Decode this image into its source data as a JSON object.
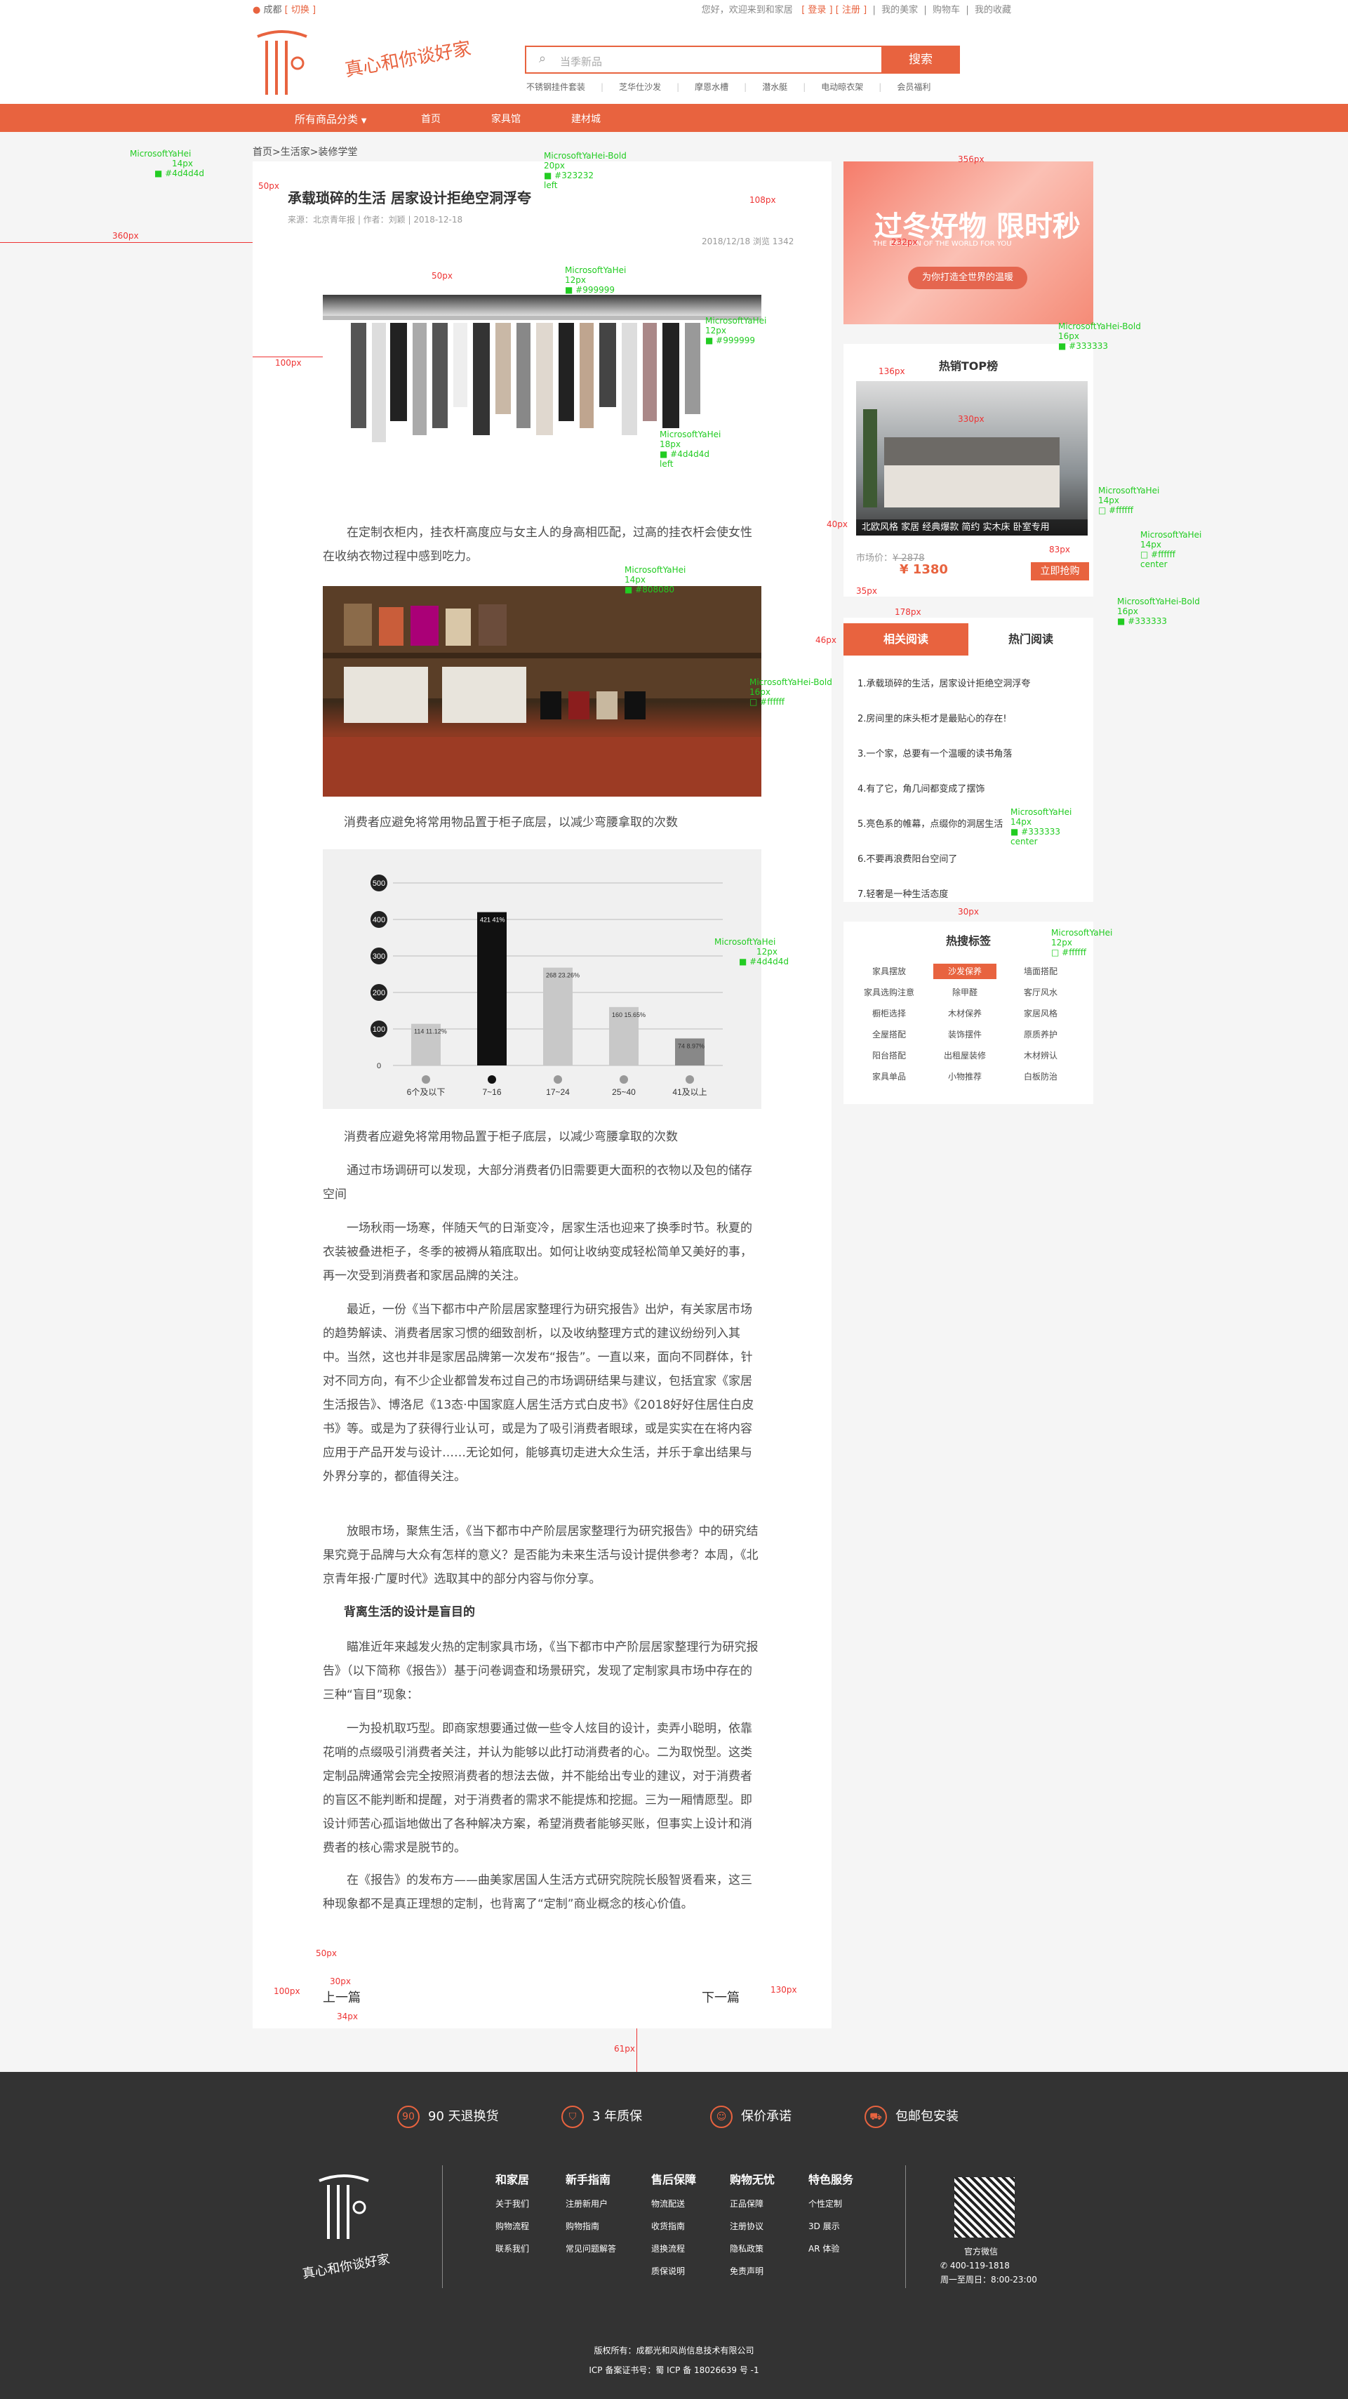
{
  "topbar": {
    "location": "成都",
    "switch": "[ 切换 ]",
    "welcome": "您好，欢迎来到和家居",
    "login": "[ 登录 ]",
    "register": "[ 注册 ]",
    "my_home": "我的美家",
    "cart": "购物车",
    "favorites": "我的收藏"
  },
  "header": {
    "slogan": "真心和你谈好家",
    "search_placeholder": "当季新品",
    "search_button": "搜索",
    "hotwords": [
      "不锈钢挂件套装",
      "芝华仕沙发",
      "摩恩水槽",
      "潜水艇",
      "电动晾衣架",
      "会员福利"
    ]
  },
  "nav": {
    "category": "所有商品分类",
    "items": [
      "首页",
      "家具馆",
      "建材城"
    ]
  },
  "article": {
    "breadcrumb": "首页>生活家>装修学堂",
    "title": "承载琐碎的生活 居家设计拒绝空洞浮夸",
    "meta": "来源：北京青年报  |  作者：刘颖  |  2018-12-18",
    "side_meta": "2018/12/18    浏览 1342",
    "p1": "在定制衣柜内，挂衣杆高度应与女主人的身高相匹配，过高的挂衣杆会使女性在收纳衣物过程中感到吃力。",
    "p2": "消费者应避免将常用物品置于柜子底层，以减少弯腰拿取的次数",
    "p3": "消费者应避免将常用物品置于柜子底层，以减少弯腰拿取的次数",
    "p4": "通过市场调研可以发现，大部分消费者仍旧需要更大面积的衣物以及包的储存空间",
    "p5": "一场秋雨一场寒，伴随天气的日渐变冷，居家生活也迎来了换季时节。秋夏的衣装被叠进柜子，冬季的被褥从箱底取出。如何让收纳变成轻松简单又美好的事，再一次受到消费者和家居品牌的关注。",
    "p6": "最近，一份《当下都市中产阶层居家整理行为研究报告》出炉，有关家居市场的趋势解读、消费者居家习惯的细致剖析，以及收纳整理方式的建议纷纷列入其中。当然，这也并非是家居品牌第一次发布“报告”。一直以来，面向不同群体，针对不同方向，有不少企业都曾发布过自己的市场调研结果与建议，包括宜家《家居生活报告》、博洛尼《13态·中国家庭人居生活方式白皮书》《2018好好住居住白皮书》等。或是为了获得行业认可，或是为了吸引消费者眼球，或是实实在在将内容应用于产品开发与设计……无论如何，能够真切走进大众生活，并乐于拿出结果与外界分享的，都值得关注。",
    "p7": "放眼市场，聚焦生活，《当下都市中产阶层居家整理行为研究报告》中的研究结果究竟于品牌与大众有怎样的意义？是否能为未来生活与设计提供参考？本周，《北京青年报·广厦时代》选取其中的部分内容与你分享。",
    "section_title": "背离生活的设计是盲目的",
    "p8": "瞄准近年来越发火热的定制家具市场，《当下都市中产阶层居家整理行为研究报告》（以下简称《报告》）基于问卷调查和场景研究，发现了定制家具市场中存在的三种“盲目”现象：",
    "p9": "一为投机取巧型。即商家想要通过做一些令人炫目的设计，卖弄小聪明，依靠花哨的点缀吸引消费者关注，并认为能够以此打动消费者的心。二为取悦型。这类定制品牌通常会完全按照消费者的想法去做，并不能给出专业的建议，对于消费者的盲区不能判断和提醒，对于消费者的需求不能提炼和挖掘。三为一厢情愿型。即设计师苦心孤诣地做出了各种解决方案，希望消费者能够买账，但事实上设计和消费者的核心需求是脱节的。",
    "p10": "在《报告》的发布方——曲美家居国人生活方式研究院院长殷智贤看来，这三种现象都不是真正理想的定制，也背离了“定制”商业概念的核心价值。",
    "prev": "上一篇",
    "next": "下一篇"
  },
  "chart_data": {
    "type": "bar",
    "categories": [
      "6个及以下",
      "7~16",
      "17~24",
      "25~40",
      "41及以上"
    ],
    "values": [
      114,
      420,
      268,
      160,
      74
    ],
    "data_labels": [
      "114 11.12%",
      "421 41%",
      "268 23.26%",
      "160 15.65%",
      "74 8.97%"
    ],
    "ylim": [
      0,
      500
    ],
    "yticks": [
      0,
      100,
      200,
      300,
      400,
      500
    ],
    "highlight_index": 1,
    "colors": {
      "bar": "#c8c8c8",
      "highlight": "#111111",
      "last": "#888888"
    }
  },
  "sidebar": {
    "banner": {
      "title": "过冬好物 限时秒",
      "subtitle": "THE BARGAIN OF THE WORLD FOR YOU",
      "button": "为你打造全世界的温暖"
    },
    "top_title": "热销TOP榜",
    "product_caption": "北欧风格 家居 经典爆款 简约 实木床 卧室专用",
    "market_price_label": "市场价：",
    "market_price": "¥ 2878",
    "price": "¥ 1380",
    "buy": "立即抢购",
    "tab_related": "相关阅读",
    "tab_hot": "热门阅读",
    "read_list": [
      "1.承载琐碎的生活，居家设计拒绝空洞浮夸",
      "2.房间里的床头柜才是最贴心的存在!",
      "3.一个家，总要有一个温暖的读书角落",
      "4.有了它，角几间都变成了摆饰",
      "5.亮色系的帷幕，点缀你的洞居生活",
      "6.不要再浪费阳台空间了",
      "7.轻奢是一种生活态度"
    ],
    "tags_title": "热搜标签",
    "tags": [
      "家具摆放",
      "沙发保养",
      "墙面搭配",
      "家具选购注意",
      "除甲醛",
      "客厅风水",
      "橱柜选择",
      "木材保养",
      "家居风格",
      "全屋搭配",
      "装饰摆件",
      "原质养护",
      "阳台搭配",
      "出租屋装修",
      "木材辨认",
      "家具单品",
      "小物推荐",
      "白板防治"
    ],
    "active_tag": 1
  },
  "footer": {
    "services": [
      "90 天退换货",
      "3 年质保",
      "保价承诺",
      "包邮包安装"
    ],
    "service_icons": [
      "90-icon",
      "shield-icon",
      "person-icon",
      "truck-icon"
    ],
    "slogan": "真心和你谈好家",
    "cols": [
      {
        "h": "和家居",
        "items": [
          "关于我们",
          "购物流程",
          "联系我们"
        ]
      },
      {
        "h": "新手指南",
        "items": [
          "注册新用户",
          "购物指南",
          "常见问题解答"
        ]
      },
      {
        "h": "售后保障",
        "items": [
          "物流配送",
          "收货指南",
          "退换流程",
          "质保说明"
        ]
      },
      {
        "h": "购物无忧",
        "items": [
          "正品保障",
          "注册协议",
          "隐私政策",
          "免责声明"
        ]
      },
      {
        "h": "特色服务",
        "items": [
          "个性定制",
          "3D 展示",
          "AR 体验"
        ]
      }
    ],
    "wechat": "官方微信",
    "phone": "400-119-1818",
    "hours": "周一至周日：8:00-23:00",
    "copyright": "版权所有：成都光和风尚信息技术有限公司",
    "icp": "ICP 备案证书号：蜀 ICP 备 18026639 号 -1"
  },
  "annotations": {
    "font_regular": "MicrosoftYaHei",
    "font_bold": "MicrosoftYaHei-Bold",
    "size12": "12px",
    "size14": "14px",
    "size16": "16px",
    "size17": "17px",
    "size18": "18px",
    "size20": "20px",
    "c4d": "■ #4d4d4d",
    "c32": "■ #323232",
    "c33": "■ #333333",
    "c99": "■ #999999",
    "c80": "■ #808080",
    "cff": "□ #ffffff",
    "ce8": "■ #e8633f",
    "left": "left",
    "center": "center",
    "m360": "360px",
    "m100": "100px",
    "m50": "50px",
    "m20": "20px",
    "m30": "30px",
    "m40": "40px",
    "m18": "18px",
    "m9": "9px",
    "m10": "10px",
    "m38": "38px",
    "m12": "12px",
    "m3": "3px",
    "m6": "6px",
    "m108": "108px",
    "m356": "356px",
    "m232": "232px",
    "m136": "136px",
    "m330": "330px",
    "m15": "15px",
    "m178": "178px",
    "m46": "46px",
    "m57": "57px",
    "m83": "83px",
    "m26": "26px",
    "m11": "11px",
    "m35": "35px",
    "m34": "34px",
    "m61": "61px",
    "m130": "130px"
  }
}
